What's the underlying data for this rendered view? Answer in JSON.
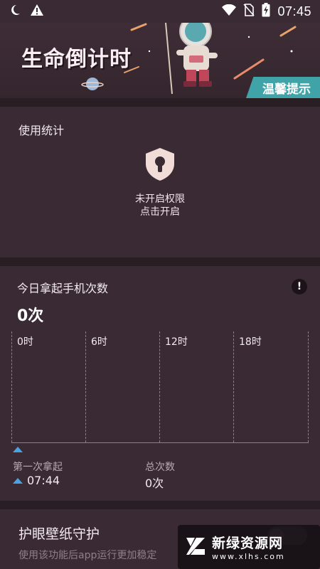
{
  "status_bar": {
    "time": "07:45",
    "left_icons": [
      "moon-icon",
      "warning-icon"
    ],
    "right_icons": [
      "wifi-icon",
      "no-sim-icon",
      "battery-charging-icon"
    ]
  },
  "banner": {
    "title": "生命倒计时",
    "tip_label": "温馨提示"
  },
  "usage_stats": {
    "title": "使用统计",
    "permission_line1": "未开启权限",
    "permission_line2": "点击开启",
    "icon": "lock-shield-icon"
  },
  "pickups": {
    "title": "今日拿起手机次数",
    "count": "0次",
    "hours": [
      "0时",
      "6时",
      "12时",
      "18时"
    ],
    "first_pickup_label": "第一次拿起",
    "first_pickup_value": "07:44",
    "total_label": "总次数",
    "total_value": "0次",
    "info_icon": "info-icon"
  },
  "eye_care": {
    "title": "护眼壁纸守护",
    "subtitle": "使用该功能后app运行更加稳定"
  },
  "watermark": {
    "cn": "新绿资源网",
    "en": "www.xlhs.com"
  },
  "colors": {
    "background": "#3a2a33",
    "accent_teal": "#3fa3a7",
    "marker_blue": "#4aa3de"
  }
}
